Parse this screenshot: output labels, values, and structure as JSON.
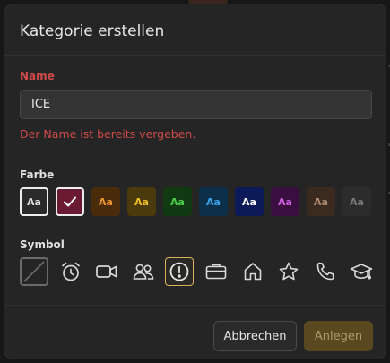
{
  "dialog": {
    "title": "Kategorie erstellen",
    "name_label": "Name",
    "name_value": "ICE",
    "name_error": "Der Name ist bereits vergeben.",
    "color_label": "Farbe",
    "symbol_label": "Symbol",
    "cancel_label": "Abbrechen",
    "create_label": "Anlegen"
  },
  "colors": [
    {
      "label": "Aa",
      "bg": "#2a2a2a",
      "fg": "#dddddd",
      "outlined": true,
      "selected": false
    },
    {
      "label": "",
      "bg": "#6b1a33",
      "fg": "#ffffff",
      "outlined": true,
      "selected": true
    },
    {
      "label": "Aa",
      "bg": "#4a2c0c",
      "fg": "#f0952c",
      "outlined": false,
      "selected": false
    },
    {
      "label": "Aa",
      "bg": "#4a3a0c",
      "fg": "#f0c02c",
      "outlined": false,
      "selected": false
    },
    {
      "label": "Aa",
      "bg": "#113a12",
      "fg": "#4cd04c",
      "outlined": false,
      "selected": false
    },
    {
      "label": "Aa",
      "bg": "#0c304a",
      "fg": "#3aa4f0",
      "outlined": false,
      "selected": false
    },
    {
      "label": "Aa",
      "bg": "#0c1a5a",
      "fg": "#ffffff",
      "outlined": false,
      "selected": false
    },
    {
      "label": "Aa",
      "bg": "#3a0f40",
      "fg": "#d060e0",
      "outlined": false,
      "selected": false
    },
    {
      "label": "Aa",
      "bg": "#3a2a20",
      "fg": "#b08a70",
      "outlined": false,
      "selected": false
    },
    {
      "label": "Aa",
      "bg": "#2c2c2c",
      "fg": "#7a7a7a",
      "outlined": false,
      "selected": false
    }
  ],
  "symbols": [
    {
      "icon": "no-symbol-icon",
      "selected": false
    },
    {
      "icon": "alarm-clock-icon",
      "selected": false
    },
    {
      "icon": "video-camera-icon",
      "selected": false
    },
    {
      "icon": "people-icon",
      "selected": false
    },
    {
      "icon": "exclamation-circle-icon",
      "selected": true
    },
    {
      "icon": "briefcase-icon",
      "selected": false
    },
    {
      "icon": "home-icon",
      "selected": false
    },
    {
      "icon": "star-icon",
      "selected": false
    },
    {
      "icon": "phone-icon",
      "selected": false
    },
    {
      "icon": "graduation-cap-icon",
      "selected": false
    }
  ],
  "theme": {
    "accent": "#d8b25a",
    "error": "#d24a4a"
  }
}
